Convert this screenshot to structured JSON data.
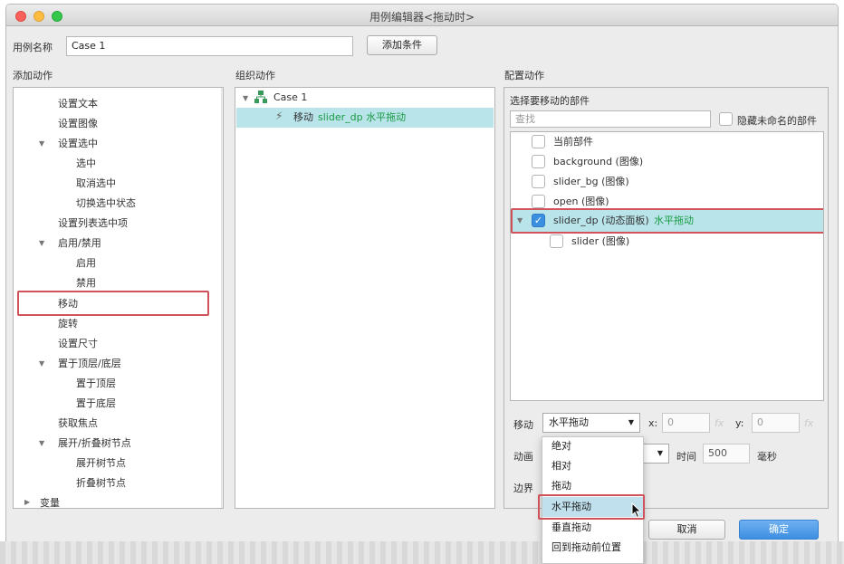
{
  "window": {
    "title": "用例编辑器<拖动时>"
  },
  "case_name": {
    "label": "用例名称",
    "value": "Case 1",
    "add_condition_label": "添加条件"
  },
  "add_actions": {
    "header": "添加动作",
    "items": [
      "设置文本",
      "设置图像",
      "设置选中",
      "选中",
      "取消选中",
      "切换选中状态",
      "设置列表选中项",
      "启用/禁用",
      "启用",
      "禁用",
      "移动",
      "旋转",
      "设置尺寸",
      "置于顶层/底层",
      "置于顶层",
      "置于底层",
      "获取焦点",
      "展开/折叠树节点",
      "展开树节点",
      "折叠树节点",
      "变量"
    ]
  },
  "organize_actions": {
    "header": "组织动作",
    "case_label": "Case 1",
    "action_prefix": "移动",
    "action_detail": "slider_dp 水平拖动"
  },
  "configure_actions": {
    "header": "配置动作",
    "select_parts_label": "选择要移动的部件",
    "search_placeholder": "查找",
    "hide_unnamed_label": "隐藏未命名的部件",
    "parts": [
      {
        "name": "当前部件",
        "checked": false
      },
      {
        "name": "background (图像)",
        "checked": false
      },
      {
        "name": "slider_bg (图像)",
        "checked": false
      },
      {
        "name": "open (图像)",
        "checked": false
      },
      {
        "name": "slider_dp (动态面板)",
        "suffix": "水平拖动",
        "checked": true
      },
      {
        "name": "slider (图像)",
        "checked": false
      }
    ],
    "move_label": "移动",
    "move_value": "水平拖动",
    "x_label": "x:",
    "x_value": "0",
    "y_label": "y:",
    "y_value": "0",
    "fx_label": "fx",
    "animate_label": "动画",
    "time_label": "时间",
    "time_value": "500",
    "ms_label": "毫秒",
    "boundary_label": "边界"
  },
  "move_dropdown": {
    "options": [
      "绝对",
      "相对",
      "拖动",
      "水平拖动",
      "垂直拖动",
      "回到拖动前位置"
    ],
    "selected_index": 3
  },
  "footer": {
    "cancel_label": "取消",
    "ok_label": "确定"
  },
  "colors": {
    "selection": "#b9e4ea",
    "highlight_border": "#d0535b",
    "accent_text": "#1a9a44",
    "primary_button": "#3e8ee2"
  }
}
